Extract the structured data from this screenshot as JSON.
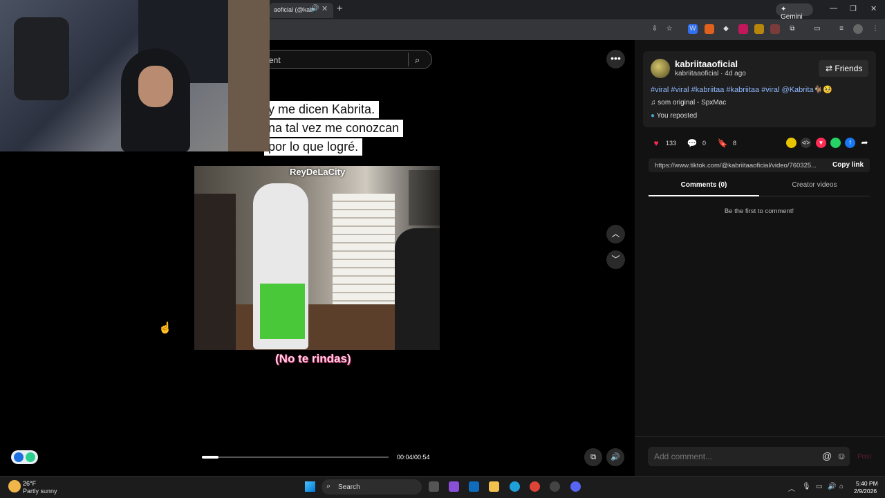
{
  "browser": {
    "tab_title": "aoficial (@kab",
    "gemini_label": "Gemini"
  },
  "video": {
    "search_placeholder": "ent",
    "caption_lines": [
      "y me dicen Kabrita.",
      "na tal vez me conozcan",
      "por lo que logré."
    ],
    "watermark": "ReyDeLaCity",
    "subtitle": "(No te rindas)",
    "time": "00:04/00:54",
    "progress": 0.09
  },
  "post": {
    "username": "kabriitaaoficial",
    "handle_line": "kabriitaaoficial · 4d ago",
    "friends_label": "Friends",
    "hashtags": "#viral #viral #kabriitaa #kabriitaa #viral @Kabrita🐐🥺",
    "sound": "som original - SpxMac",
    "repost": "You reposted",
    "likes": "133",
    "comments": "0",
    "saves": "8",
    "link": "https://www.tiktok.com/@kabriitaaoficial/video/760325...",
    "copy_link_label": "Copy link",
    "tab_comments": "Comments (0)",
    "tab_creator": "Creator videos",
    "empty_comments": "Be the first to comment!",
    "add_comment_placeholder": "Add comment...",
    "post_label": "Post"
  },
  "taskbar": {
    "weather_temp": "26°F",
    "weather_desc": "Partly sunny",
    "search_label": "Search",
    "time": "5:40 PM",
    "date": "2/9/2026"
  },
  "colors": {
    "like": "#fe2c55",
    "hashtag": "#8fb8ff",
    "panel_bg": "#121212"
  }
}
